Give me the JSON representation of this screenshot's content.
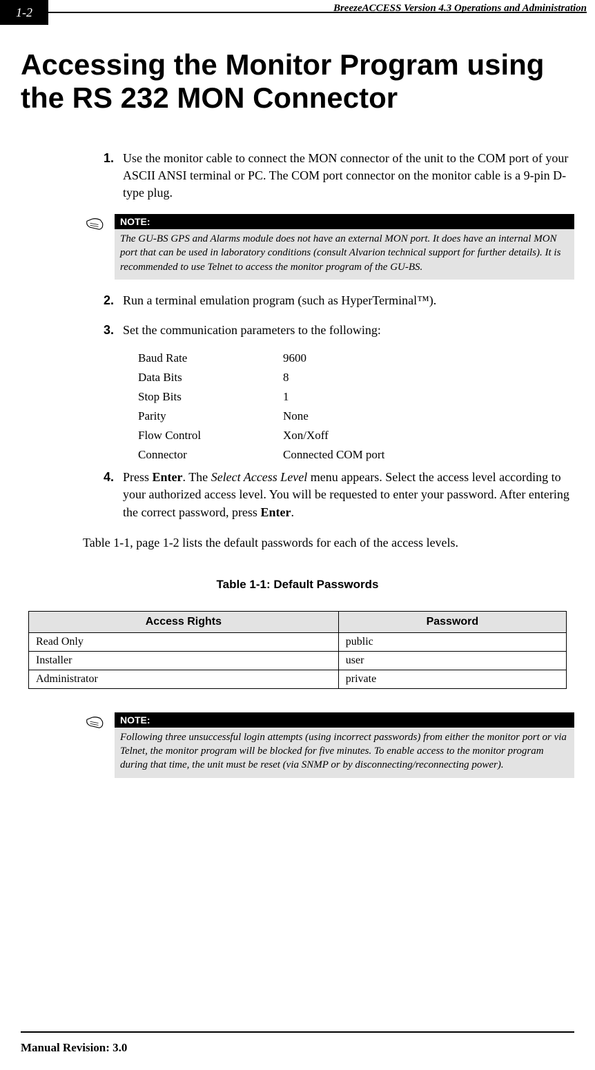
{
  "header": {
    "page_number": "1-2",
    "running_title": "BreezeACCESS Version 4.3 Operations and Administration"
  },
  "title": "Accessing the Monitor Program using the RS 232 MON Connector",
  "steps": {
    "s1": {
      "num": "1.",
      "text": "Use the monitor cable to connect the MON connector of the unit to the COM port of your ASCII ANSI terminal or PC. The COM port connector on the monitor cable is a 9-pin D-type plug."
    },
    "s2": {
      "num": "2.",
      "text": "Run a terminal emulation program (such as HyperTerminal™)."
    },
    "s3": {
      "num": "3.",
      "text": "Set the communication parameters to the following:"
    },
    "s4": {
      "num": "4.",
      "prefix": "Press ",
      "kbd1": "Enter",
      "mid1": ". The ",
      "ital": "Select Access Level",
      "mid2": " menu appears. Select the access level according to your authorized access level. You will be requested to enter your password. After entering the correct password, press ",
      "kbd2": "Enter",
      "suffix": "."
    }
  },
  "note1": {
    "label": "NOTE:",
    "text": "The GU-BS GPS and Alarms module does not have an external MON port. It does have an internal MON port that can be used in laboratory conditions (consult Alvarion technical support for further details). It is recommended to use Telnet to access the monitor program of the GU-BS."
  },
  "params": [
    {
      "k": "Baud Rate",
      "v": "9600"
    },
    {
      "k": "Data Bits",
      "v": "8"
    },
    {
      "k": "Stop Bits",
      "v": "1"
    },
    {
      "k": "Parity",
      "v": "None"
    },
    {
      "k": "Flow Control",
      "v": "Xon/Xoff"
    },
    {
      "k": "Connector",
      "v": "Connected COM port"
    }
  ],
  "table_ref": "Table 1-1, page 1-2 lists the default passwords for each of the access levels.",
  "table_caption": "Table 1-1: Default Passwords",
  "table_headers": {
    "col1": "Access Rights",
    "col2": "Password"
  },
  "table_rows": [
    {
      "rights": "Read Only",
      "password": "public"
    },
    {
      "rights": "Installer",
      "password": "user"
    },
    {
      "rights": "Administrator",
      "password": "private"
    }
  ],
  "note2": {
    "label": "NOTE:",
    "text": "Following three unsuccessful login attempts (using incorrect passwords) from either the monitor port or via Telnet, the monitor program will be blocked for five minutes. To enable access to the monitor program during that time, the unit must be reset (via SNMP or by disconnecting/reconnecting power)."
  },
  "footer": "Manual Revision: 3.0"
}
